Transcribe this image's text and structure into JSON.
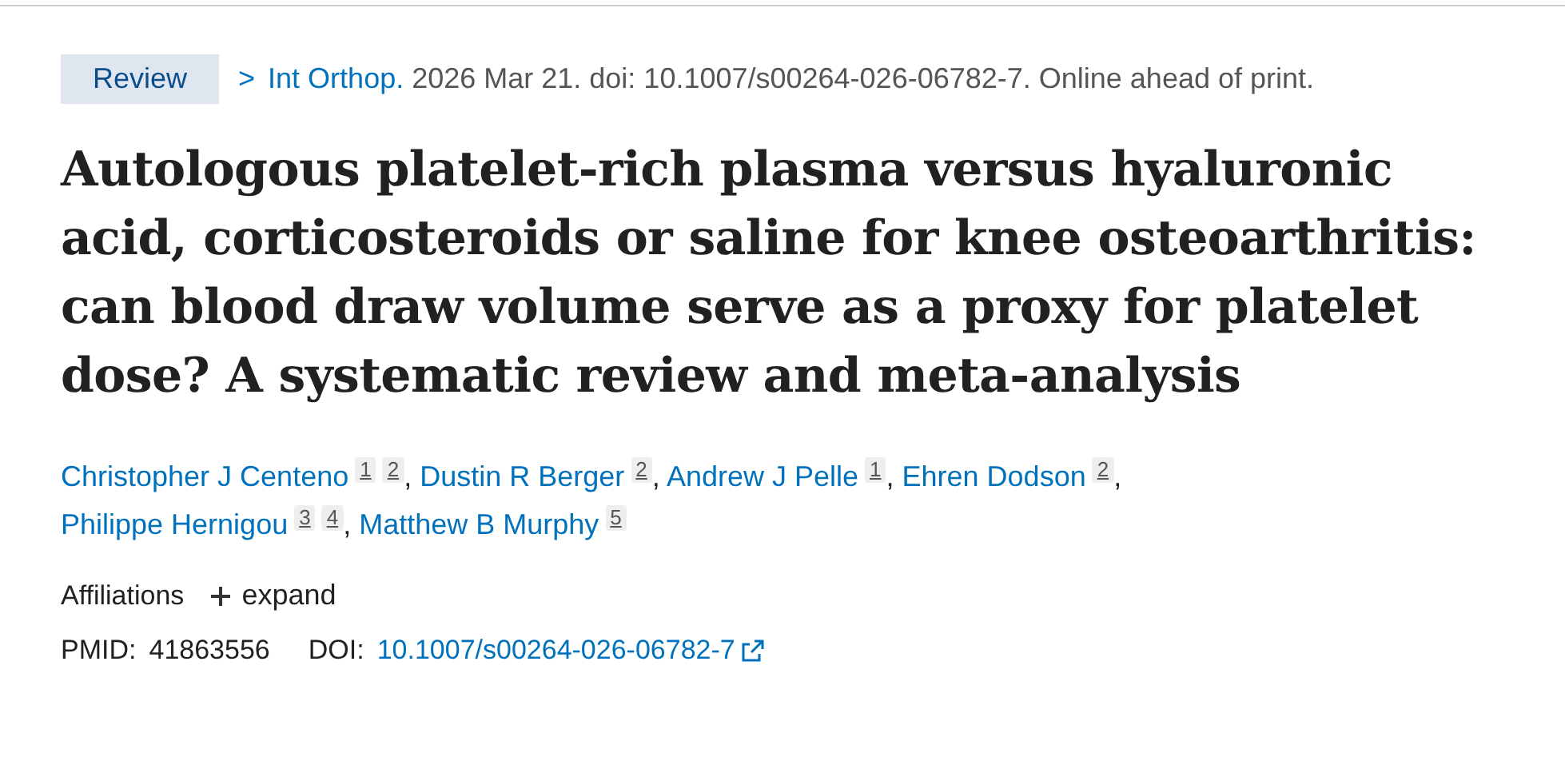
{
  "publication_type": "Review",
  "journal": {
    "chevron": ">",
    "name": "Int Orthop.",
    "citation": "2026 Mar 21. doi: 10.1007/s00264-026-06782-7. Online ahead of print."
  },
  "title": "Autologous platelet-rich plasma versus hyaluronic acid, corticosteroids or saline for knee osteoarthritis: can blood draw volume serve as a proxy for platelet dose? A systematic review and meta-analysis",
  "authors": [
    {
      "name": "Christopher J Centeno",
      "affiliations": [
        "1",
        "2"
      ],
      "separator": ","
    },
    {
      "name": "Dustin R Berger",
      "affiliations": [
        "2"
      ],
      "separator": ","
    },
    {
      "name": "Andrew J Pelle",
      "affiliations": [
        "1"
      ],
      "separator": ","
    },
    {
      "name": "Ehren Dodson",
      "affiliations": [
        "2"
      ],
      "separator": ","
    },
    {
      "name": "Philippe Hernigou",
      "affiliations": [
        "3",
        "4"
      ],
      "separator": ","
    },
    {
      "name": "Matthew B Murphy",
      "affiliations": [
        "5"
      ]
    }
  ],
  "affiliations": {
    "label": "Affiliations",
    "toggle": "expand",
    "expanded": false
  },
  "identifiers": {
    "pmid_label": "PMID:",
    "pmid": "41863556",
    "doi_label": "DOI:",
    "doi": "10.1007/s00264-026-06782-7"
  }
}
